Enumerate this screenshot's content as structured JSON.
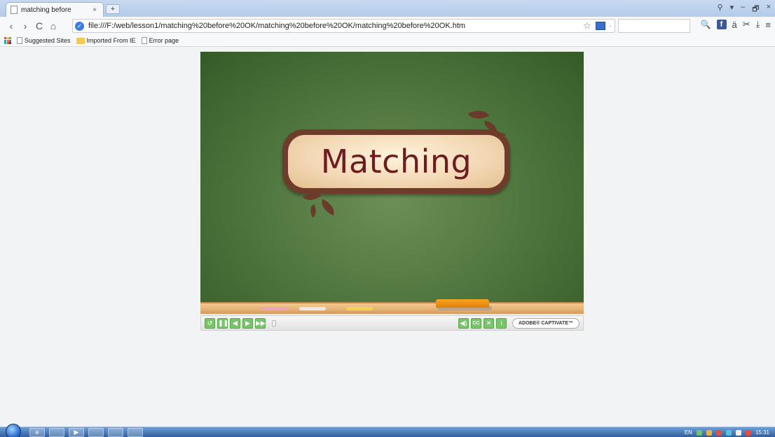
{
  "browser": {
    "tab": {
      "title": "matching before",
      "close": "×"
    },
    "new_tab": "+",
    "window_controls": [
      "⚲",
      "▾",
      "–",
      "🗗",
      "×"
    ],
    "nav": {
      "back": "‹",
      "forward": "›",
      "reload": "C",
      "home": "⌂"
    },
    "url": "file:///F:/web/lesson1/matching%20before%20OK/matching%20before%20OK/matching%20before%20OK.htm",
    "star": "☆",
    "dropdown_marker": "·",
    "right_tools": {
      "search": "🔍",
      "facebook": "f",
      "icon_a": "ä",
      "scissors": "✂",
      "download": "⤓",
      "menu": "≡"
    },
    "bookmarks": [
      {
        "label": "Suggested Sites",
        "icon": "page-icon"
      },
      {
        "label": "Imported From IE",
        "icon": "folder-icon"
      },
      {
        "label": "Error page",
        "icon": "page-icon"
      }
    ],
    "apps_colors": [
      "#e74c3c",
      "#f1c40f",
      "#2ecc71",
      "#3498db",
      "#e67e22",
      "#9b59b6",
      "#1abc9c",
      "#e74c3c",
      "#34495e"
    ]
  },
  "slide": {
    "title": "Matching",
    "board_color": "#557b43",
    "sign_border_color": "#6f3c2b",
    "title_color": "#6d1d1f"
  },
  "playbar": {
    "buttons": [
      {
        "name": "rewind-button",
        "glyph": "↺"
      },
      {
        "name": "pause-button",
        "glyph": "❚❚"
      },
      {
        "name": "back-button",
        "glyph": "◀"
      },
      {
        "name": "forward-button",
        "glyph": "▶"
      },
      {
        "name": "fast-forward-button",
        "glyph": "▶▶"
      }
    ],
    "right_buttons": [
      {
        "name": "audio-button",
        "glyph": "◀)"
      },
      {
        "name": "closed-caption-button",
        "glyph": "CC"
      },
      {
        "name": "exit-button",
        "glyph": "✕"
      },
      {
        "name": "info-button",
        "glyph": "i"
      }
    ],
    "captivate_label": "ADOBE® CAPTIVATE™",
    "accent": "#7cc36d"
  },
  "taskbar": {
    "language": "EN",
    "time": "15:31"
  }
}
